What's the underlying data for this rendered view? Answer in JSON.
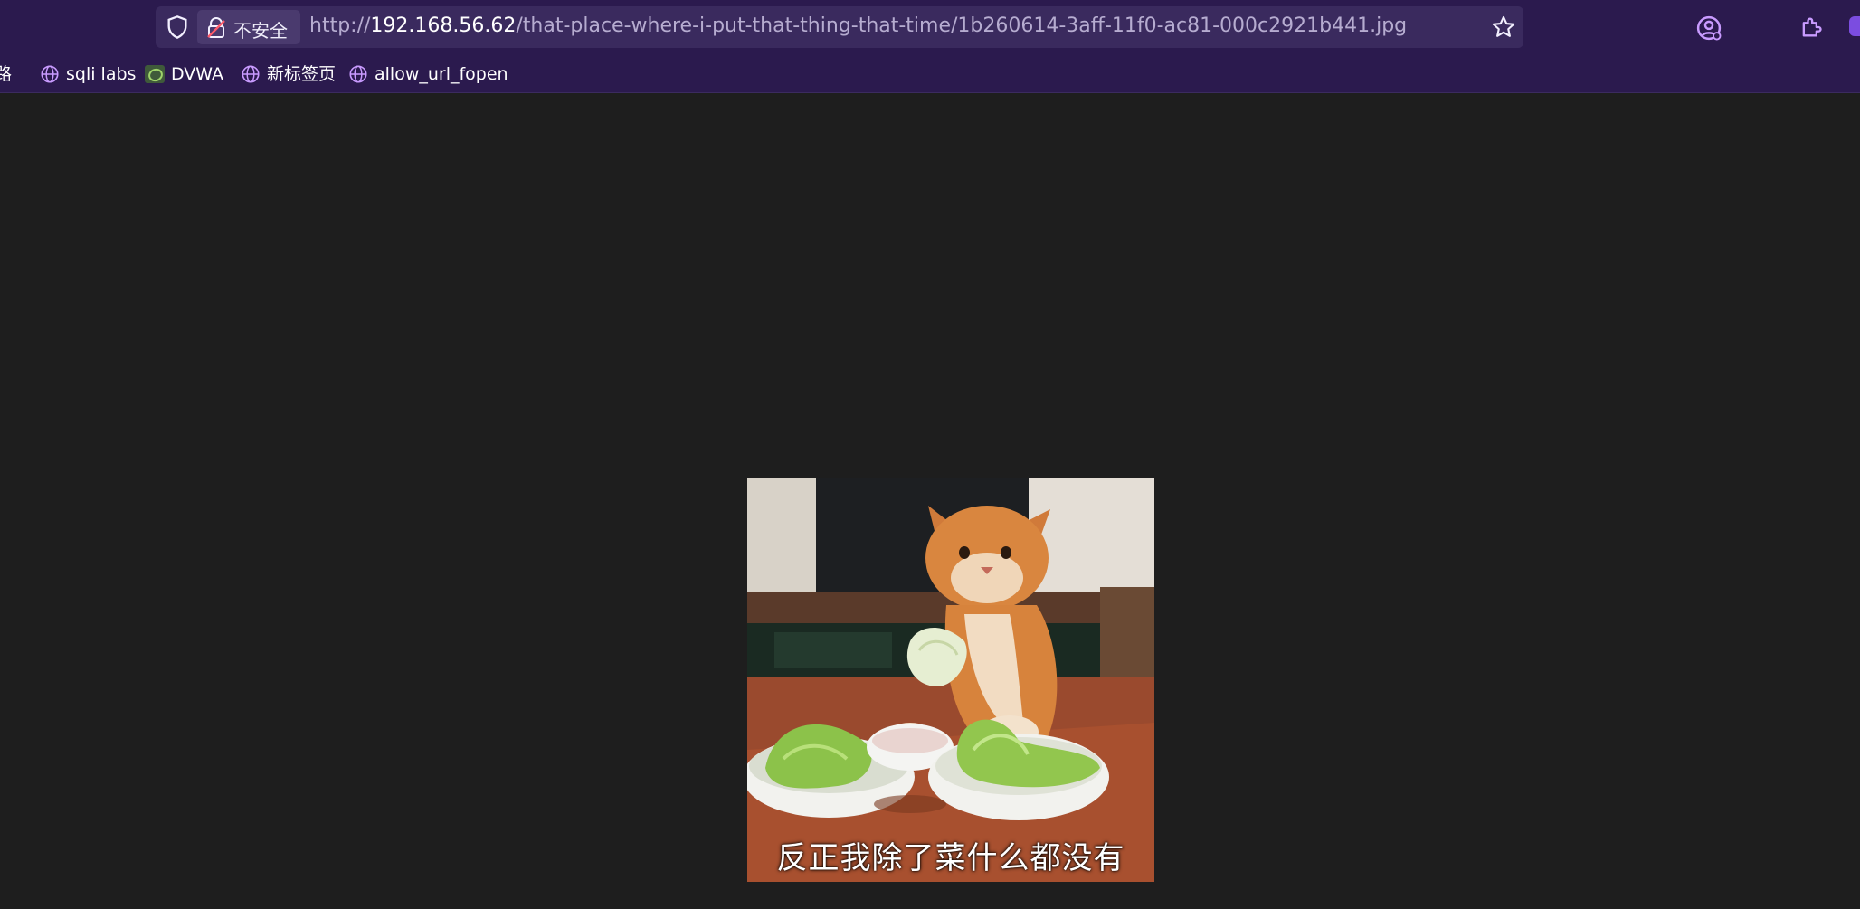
{
  "toolbar": {
    "security_label": "不安全",
    "url": {
      "scheme": "http://",
      "host": "192.168.56.62",
      "path": "/that-place-where-i-put-that-thing-that-time/1b260614-3aff-11f0-ac81-000c2921b441.jpg"
    },
    "icons": [
      "shield-icon",
      "insecure-lock-icon",
      "bookmark-star-icon",
      "account-icon",
      "extensions-icon"
    ]
  },
  "bookmarks": [
    {
      "label": "路",
      "icon": "none"
    },
    {
      "label": "sqli labs",
      "icon": "globe-icon"
    },
    {
      "label": "DVWA",
      "icon": "dvwa-icon"
    },
    {
      "label": "新标签页",
      "icon": "globe-icon"
    },
    {
      "label": "allow_url_fopen",
      "icon": "globe-icon"
    }
  ],
  "image": {
    "caption": "反正我除了菜什么都没有"
  },
  "colors": {
    "toolbar": "#2b1a4e",
    "urlbar": "#3a2a5e",
    "page_background": "#1e1e1e",
    "accent": "#b57bff"
  }
}
